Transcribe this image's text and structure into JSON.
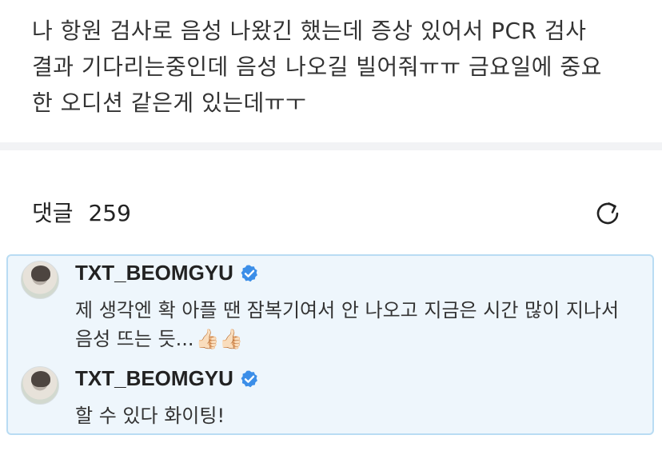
{
  "post": {
    "lines": [
      "나 항원 검사로 음성 나왔긴 했는데 증상 있어서 PCR 검사",
      "결과 기다리는중인데 음성 나오길 빌어줘ㅠㅠ 금요일에 중요",
      "한 오디션 같은게 있는데ㅠㅜ"
    ]
  },
  "comments_header": {
    "label": "댓글",
    "count": "259"
  },
  "icons": {
    "refresh": "refresh-icon",
    "verified": "verified-badge-icon",
    "thumbs_up": "thumbs-up-icon"
  },
  "colors": {
    "accent_border": "#b9dcf3",
    "highlight_bg": "#eef6fc",
    "verified": "#3b8ee8"
  },
  "comments": [
    {
      "username": "TXT_BEOMGYU",
      "verified": true,
      "lines": [
        "제 생각엔 확 아플 땐 잠복기여서 안 나오고 지금은 시간 많이 지나서",
        "음성 뜨는 듯..."
      ],
      "emoji": "👍🏻👍🏻"
    },
    {
      "username": "TXT_BEOMGYU",
      "verified": true,
      "lines": [
        "할 수 있다 화이팅!"
      ]
    }
  ]
}
